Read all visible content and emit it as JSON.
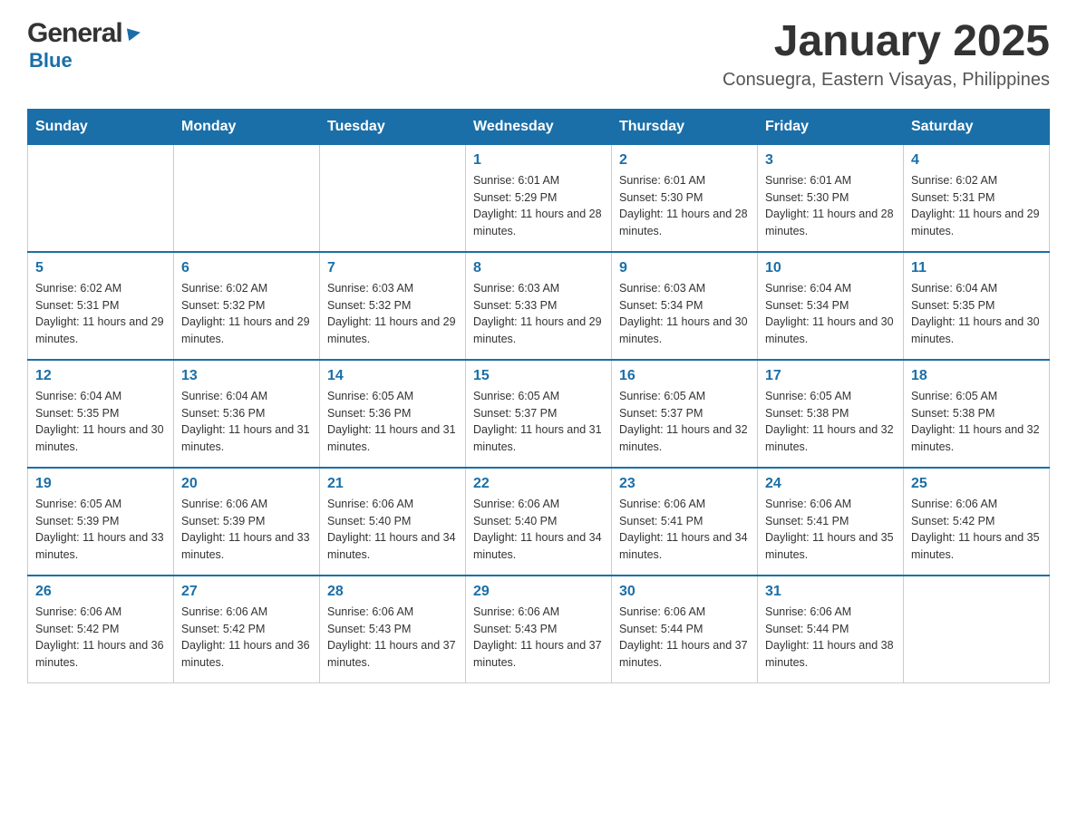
{
  "logo": {
    "general_text": "General",
    "blue_text": "Blue",
    "triangle": "▶"
  },
  "header": {
    "month_year": "January 2025",
    "location": "Consuegra, Eastern Visayas, Philippines"
  },
  "weekdays": [
    "Sunday",
    "Monday",
    "Tuesday",
    "Wednesday",
    "Thursday",
    "Friday",
    "Saturday"
  ],
  "weeks": [
    [
      {
        "day": "",
        "info": ""
      },
      {
        "day": "",
        "info": ""
      },
      {
        "day": "",
        "info": ""
      },
      {
        "day": "1",
        "info": "Sunrise: 6:01 AM\nSunset: 5:29 PM\nDaylight: 11 hours and 28 minutes."
      },
      {
        "day": "2",
        "info": "Sunrise: 6:01 AM\nSunset: 5:30 PM\nDaylight: 11 hours and 28 minutes."
      },
      {
        "day": "3",
        "info": "Sunrise: 6:01 AM\nSunset: 5:30 PM\nDaylight: 11 hours and 28 minutes."
      },
      {
        "day": "4",
        "info": "Sunrise: 6:02 AM\nSunset: 5:31 PM\nDaylight: 11 hours and 29 minutes."
      }
    ],
    [
      {
        "day": "5",
        "info": "Sunrise: 6:02 AM\nSunset: 5:31 PM\nDaylight: 11 hours and 29 minutes."
      },
      {
        "day": "6",
        "info": "Sunrise: 6:02 AM\nSunset: 5:32 PM\nDaylight: 11 hours and 29 minutes."
      },
      {
        "day": "7",
        "info": "Sunrise: 6:03 AM\nSunset: 5:32 PM\nDaylight: 11 hours and 29 minutes."
      },
      {
        "day": "8",
        "info": "Sunrise: 6:03 AM\nSunset: 5:33 PM\nDaylight: 11 hours and 29 minutes."
      },
      {
        "day": "9",
        "info": "Sunrise: 6:03 AM\nSunset: 5:34 PM\nDaylight: 11 hours and 30 minutes."
      },
      {
        "day": "10",
        "info": "Sunrise: 6:04 AM\nSunset: 5:34 PM\nDaylight: 11 hours and 30 minutes."
      },
      {
        "day": "11",
        "info": "Sunrise: 6:04 AM\nSunset: 5:35 PM\nDaylight: 11 hours and 30 minutes."
      }
    ],
    [
      {
        "day": "12",
        "info": "Sunrise: 6:04 AM\nSunset: 5:35 PM\nDaylight: 11 hours and 30 minutes."
      },
      {
        "day": "13",
        "info": "Sunrise: 6:04 AM\nSunset: 5:36 PM\nDaylight: 11 hours and 31 minutes."
      },
      {
        "day": "14",
        "info": "Sunrise: 6:05 AM\nSunset: 5:36 PM\nDaylight: 11 hours and 31 minutes."
      },
      {
        "day": "15",
        "info": "Sunrise: 6:05 AM\nSunset: 5:37 PM\nDaylight: 11 hours and 31 minutes."
      },
      {
        "day": "16",
        "info": "Sunrise: 6:05 AM\nSunset: 5:37 PM\nDaylight: 11 hours and 32 minutes."
      },
      {
        "day": "17",
        "info": "Sunrise: 6:05 AM\nSunset: 5:38 PM\nDaylight: 11 hours and 32 minutes."
      },
      {
        "day": "18",
        "info": "Sunrise: 6:05 AM\nSunset: 5:38 PM\nDaylight: 11 hours and 32 minutes."
      }
    ],
    [
      {
        "day": "19",
        "info": "Sunrise: 6:05 AM\nSunset: 5:39 PM\nDaylight: 11 hours and 33 minutes."
      },
      {
        "day": "20",
        "info": "Sunrise: 6:06 AM\nSunset: 5:39 PM\nDaylight: 11 hours and 33 minutes."
      },
      {
        "day": "21",
        "info": "Sunrise: 6:06 AM\nSunset: 5:40 PM\nDaylight: 11 hours and 34 minutes."
      },
      {
        "day": "22",
        "info": "Sunrise: 6:06 AM\nSunset: 5:40 PM\nDaylight: 11 hours and 34 minutes."
      },
      {
        "day": "23",
        "info": "Sunrise: 6:06 AM\nSunset: 5:41 PM\nDaylight: 11 hours and 34 minutes."
      },
      {
        "day": "24",
        "info": "Sunrise: 6:06 AM\nSunset: 5:41 PM\nDaylight: 11 hours and 35 minutes."
      },
      {
        "day": "25",
        "info": "Sunrise: 6:06 AM\nSunset: 5:42 PM\nDaylight: 11 hours and 35 minutes."
      }
    ],
    [
      {
        "day": "26",
        "info": "Sunrise: 6:06 AM\nSunset: 5:42 PM\nDaylight: 11 hours and 36 minutes."
      },
      {
        "day": "27",
        "info": "Sunrise: 6:06 AM\nSunset: 5:42 PM\nDaylight: 11 hours and 36 minutes."
      },
      {
        "day": "28",
        "info": "Sunrise: 6:06 AM\nSunset: 5:43 PM\nDaylight: 11 hours and 37 minutes."
      },
      {
        "day": "29",
        "info": "Sunrise: 6:06 AM\nSunset: 5:43 PM\nDaylight: 11 hours and 37 minutes."
      },
      {
        "day": "30",
        "info": "Sunrise: 6:06 AM\nSunset: 5:44 PM\nDaylight: 11 hours and 37 minutes."
      },
      {
        "day": "31",
        "info": "Sunrise: 6:06 AM\nSunset: 5:44 PM\nDaylight: 11 hours and 38 minutes."
      },
      {
        "day": "",
        "info": ""
      }
    ]
  ]
}
